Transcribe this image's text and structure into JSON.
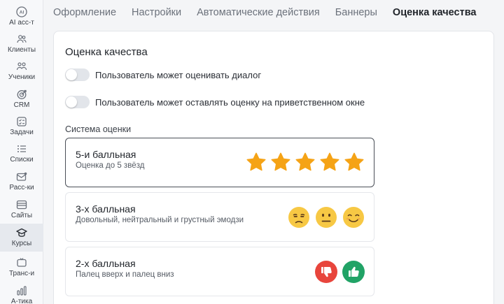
{
  "sidebar": {
    "items": [
      {
        "label": "AI асс-т",
        "icon": "ai-icon"
      },
      {
        "label": "Клиенты",
        "icon": "clients-icon"
      },
      {
        "label": "Ученики",
        "icon": "students-icon"
      },
      {
        "label": "CRM",
        "icon": "crm-icon"
      },
      {
        "label": "Задачи",
        "icon": "tasks-icon"
      },
      {
        "label": "Списки",
        "icon": "lists-icon"
      },
      {
        "label": "Расс-ки",
        "icon": "mailing-icon"
      },
      {
        "label": "Сайты",
        "icon": "sites-icon"
      },
      {
        "label": "Курсы",
        "icon": "courses-icon",
        "active": true
      },
      {
        "label": "Транс-и",
        "icon": "broadcast-icon"
      },
      {
        "label": "А-тика",
        "icon": "analytics-icon"
      }
    ]
  },
  "tabs": [
    {
      "label": "Оформление"
    },
    {
      "label": "Настройки"
    },
    {
      "label": "Автоматические действия"
    },
    {
      "label": "Баннеры"
    },
    {
      "label": "Оценка качества",
      "active": true
    }
  ],
  "card": {
    "title": "Оценка качества",
    "toggle_rate_dialog": {
      "label": "Пользователь может оценивать диалог",
      "on": false
    },
    "toggle_rate_welcome": {
      "label": "Пользователь может оставлять оценку на приветственном окне",
      "on": false
    },
    "system_label": "Система оценки",
    "options": [
      {
        "title": "5-и балльная",
        "subtitle": "Оценка до 5 звёзд",
        "selected": true
      },
      {
        "title": "3-х балльная",
        "subtitle": "Довольный, нейтральный и грустный эмодзи",
        "selected": false
      },
      {
        "title": "2-х балльная",
        "subtitle": "Палец вверх и палец вниз",
        "selected": false
      }
    ]
  },
  "colors": {
    "star": "#f5a316",
    "emoji": "#f7c844",
    "thumb_down": "#e8453c",
    "thumb_up": "#21a366",
    "active_tab": "#1f2329"
  }
}
